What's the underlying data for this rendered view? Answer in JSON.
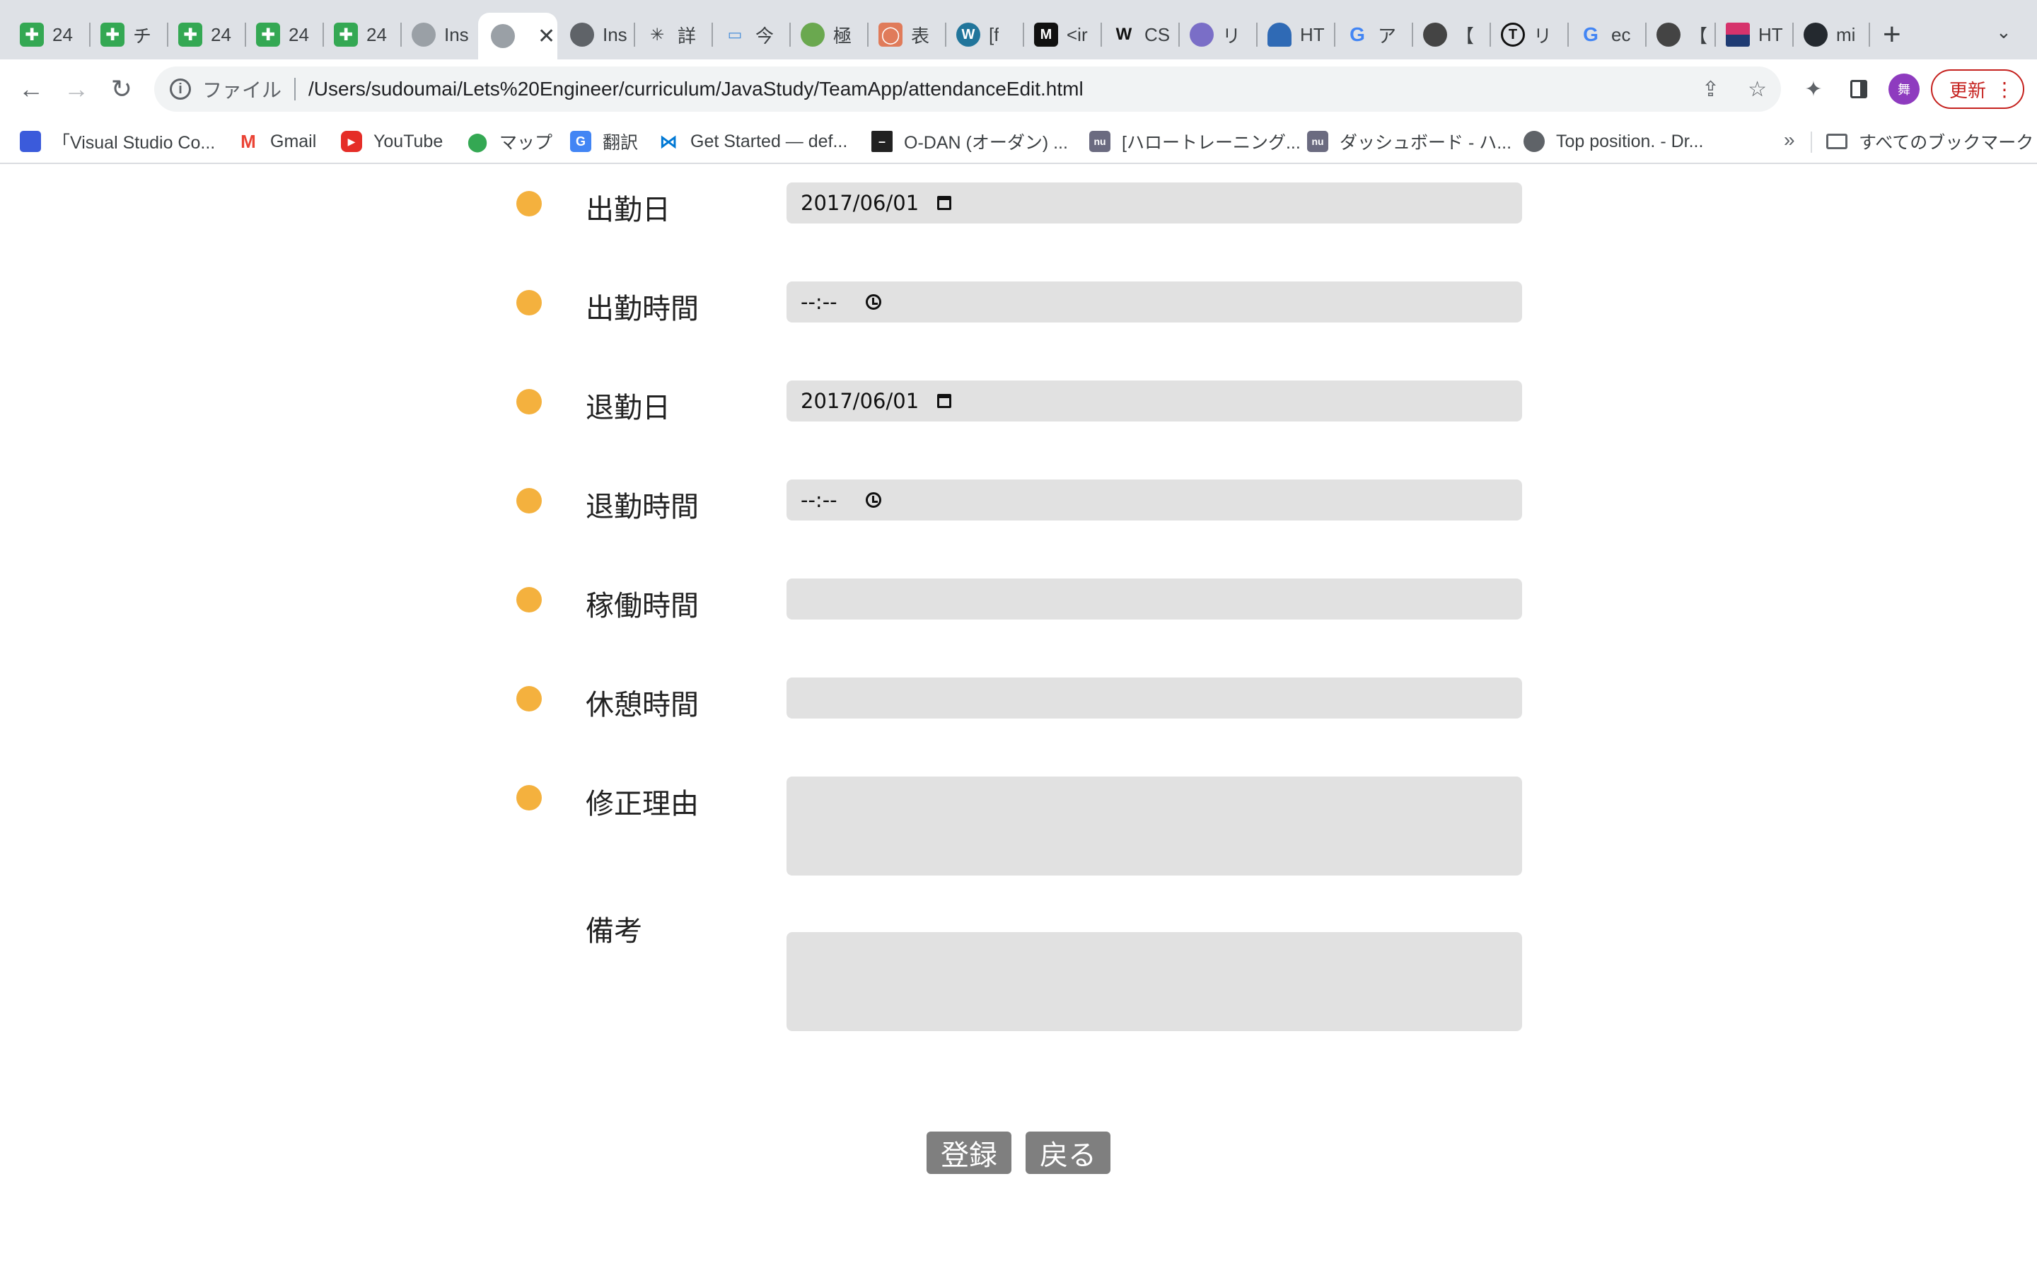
{
  "browser": {
    "tabs": [
      {
        "icon": "sheets-icon",
        "title": "24"
      },
      {
        "icon": "sheets-icon",
        "title": "チ"
      },
      {
        "icon": "sheets-icon",
        "title": "24"
      },
      {
        "icon": "sheets-icon",
        "title": "24"
      },
      {
        "icon": "sheets-icon",
        "title": "24"
      },
      {
        "icon": "globe-icon",
        "title": "Ins"
      },
      {
        "icon": "globe-icon",
        "title": "",
        "active": true
      },
      {
        "icon": "globe-icon",
        "title": "Ins"
      },
      {
        "icon": "asterisk-icon",
        "title": "詳"
      },
      {
        "icon": "doc-icon",
        "title": "今"
      },
      {
        "icon": "leaf-icon",
        "title": "極"
      },
      {
        "icon": "ring-icon",
        "title": "表"
      },
      {
        "icon": "wordpress-icon",
        "title": "[f"
      },
      {
        "icon": "m-logo-icon",
        "title": "<ir"
      },
      {
        "icon": "w-logo-icon",
        "title": "CS"
      },
      {
        "icon": "monster-icon",
        "title": "リ"
      },
      {
        "icon": "cloud-icon",
        "title": "HT"
      },
      {
        "icon": "google-icon",
        "title": "ア"
      },
      {
        "icon": "character-icon",
        "title": "【"
      },
      {
        "icon": "t-circle-icon",
        "title": "リ"
      },
      {
        "icon": "google-icon",
        "title": "ec"
      },
      {
        "icon": "character-icon",
        "title": "【"
      },
      {
        "icon": "flag-icon",
        "title": "HT"
      },
      {
        "icon": "github-icon",
        "title": "mi"
      }
    ],
    "active_tab_close": "✕",
    "new_tab": "+",
    "tab_menu": "⌄",
    "address": {
      "scheme_label": "ファイル",
      "url": "/Users/sudoumai/Lets%20Engineer/curriculum/JavaStudy/TeamApp/attendanceEdit.html"
    },
    "avatar_text": "舞",
    "update_label": "更新",
    "bookmarks": [
      {
        "icon": "vscode-doc-icon",
        "label": "「Visual Studio Co..."
      },
      {
        "icon": "gmail-icon",
        "label": "Gmail"
      },
      {
        "icon": "youtube-icon",
        "label": "YouTube"
      },
      {
        "icon": "maps-icon",
        "label": "マップ"
      },
      {
        "icon": "translate-icon",
        "label": "翻訳"
      },
      {
        "icon": "vscode-icon",
        "label": "Get Started — def..."
      },
      {
        "icon": "odan-icon",
        "label": "O-DAN (オーダン) ..."
      },
      {
        "icon": "nu-icon",
        "label": "[ハロートレーニング..."
      },
      {
        "icon": "nu-icon",
        "label": "ダッシュボード - ハ..."
      },
      {
        "icon": "globe-icon",
        "label": "Top position. - Dr..."
      }
    ],
    "bookmarks_more": "»",
    "all_bookmarks_label": "すべてのブックマーク"
  },
  "form": {
    "rows": [
      {
        "label": "出勤日",
        "type": "date",
        "value": "2017/06/01",
        "required": true
      },
      {
        "label": "出勤時間",
        "type": "time",
        "value": "--:--",
        "required": true
      },
      {
        "label": "退勤日",
        "type": "date",
        "value": "2017/06/01",
        "required": true
      },
      {
        "label": "退勤時間",
        "type": "time",
        "value": "--:--",
        "required": true
      },
      {
        "label": "稼働時間",
        "type": "text",
        "value": "",
        "required": true
      },
      {
        "label": "休憩時間",
        "type": "text",
        "value": "",
        "required": true
      },
      {
        "label": "修正理由",
        "type": "textarea",
        "value": "",
        "required": true
      },
      {
        "label": "備考",
        "type": "textarea",
        "value": "",
        "required": false
      }
    ],
    "register_label": "登録",
    "back_label": "戻る",
    "required_dot_color": "#f4b13e",
    "field_bg_color": "#e1e1e1",
    "button_color": "#7f7f7f"
  }
}
